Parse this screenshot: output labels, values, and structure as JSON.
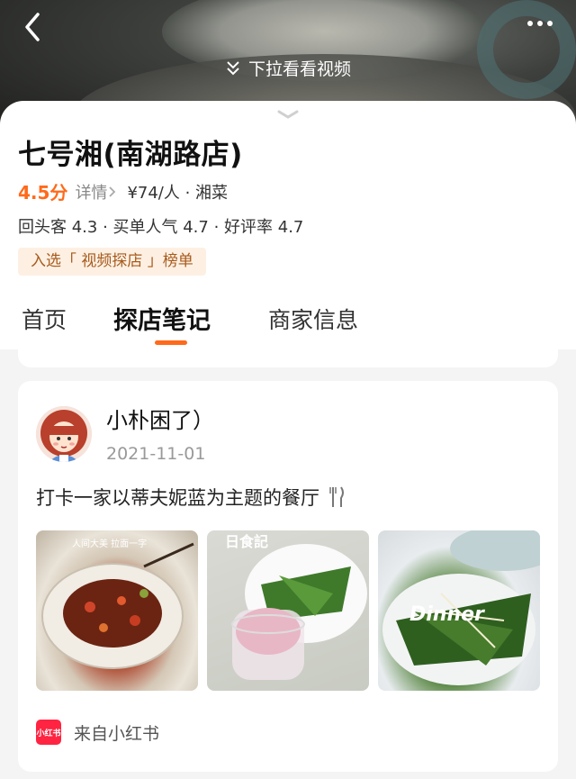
{
  "hero": {
    "pull_hint": "下拉看看视频"
  },
  "shop": {
    "name": "七号湘(南湖路店)",
    "score": "4.5分",
    "detail_label": "详情",
    "price_category": "¥74/人 · 湘菜",
    "metrics": "回头客 4.3 · 买单人气 4.7 · 好评率 4.7",
    "rank_tag": "入选「 视频探店 」榜单"
  },
  "tabs": {
    "home": "首页",
    "notes": "探店笔记",
    "merchant": "商家信息",
    "active": "notes"
  },
  "note": {
    "author": "小朴困了）",
    "date": "2021-11-01",
    "text": "打卡一家以蒂夫妮蓝为主题的餐厅",
    "photo_captions": {
      "p1": "人间大美 拉面一字",
      "p2": "日食記",
      "p3": "Dinner"
    },
    "source_logo": "小红书",
    "source": "来自小红书"
  },
  "colors": {
    "accent": "#ff6a1a",
    "tag_bg": "#fdf0e3",
    "tag_text": "#a75a1c",
    "xhs_red": "#ff2442"
  }
}
